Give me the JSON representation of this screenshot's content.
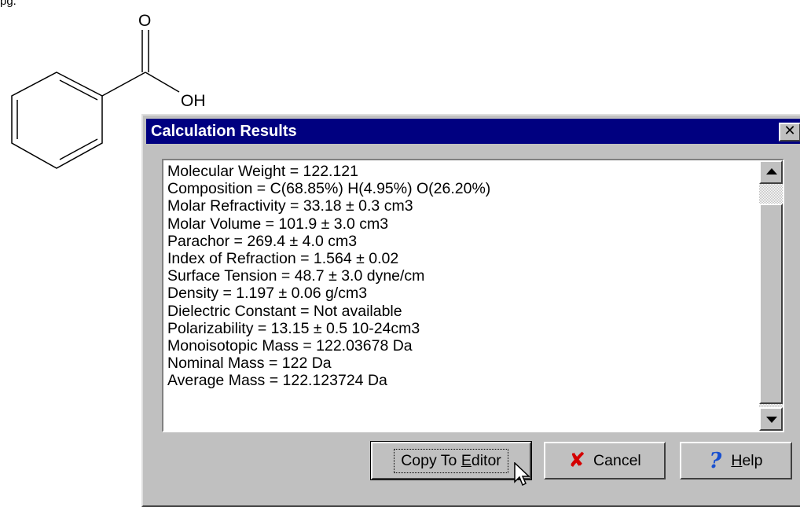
{
  "header_fragment": "pg.",
  "molecule": {
    "atom_o": "O",
    "atom_oh": "OH"
  },
  "dialog": {
    "title": "Calculation Results",
    "close_glyph": "✕",
    "results": [
      "Molecular Weight = 122.121",
      "Composition = C(68.85%) H(4.95%) O(26.20%)",
      "Molar Refractivity = 33.18 ± 0.3 cm3",
      "Molar Volume = 101.9 ± 3.0 cm3",
      "Parachor = 269.4 ± 4.0 cm3",
      "Index of Refraction = 1.564 ± 0.02",
      "Surface Tension = 48.7 ± 3.0 dyne/cm",
      "Density = 1.197 ± 0.06 g/cm3",
      "Dielectric Constant = Not available",
      "Polarizability = 13.15 ± 0.5 10-24cm3",
      "Monoisotopic Mass = 122.03678 Da",
      "Nominal Mass = 122 Da",
      "Average Mass = 122.123724 Da"
    ],
    "buttons": {
      "copy_pre": "Copy To ",
      "copy_key": "E",
      "copy_post": "ditor",
      "cancel_icon": "✘",
      "cancel": "Cancel",
      "help_icon": "?",
      "help_key": "H",
      "help_post": "elp"
    }
  },
  "icons": {
    "cancel": "red-x-icon",
    "help": "question-mark-icon",
    "cursor": "mouse-pointer-icon"
  }
}
